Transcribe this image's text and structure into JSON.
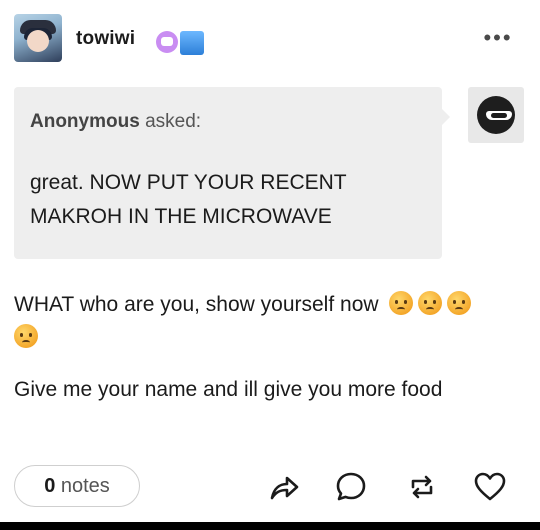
{
  "post": {
    "username": "towiwi",
    "more_label": "•••",
    "badges": [
      "sticker-badge",
      "blue-badge"
    ]
  },
  "ask": {
    "asker_name": "Anonymous",
    "asked_label": "asked:",
    "question": "great. NOW PUT YOUR RECENT MAKROH IN THE MICROWAVE"
  },
  "answer": {
    "line1": "WHAT who are you, show yourself now",
    "line2": "Give me your name and ill give you more food",
    "emoji_count": 4,
    "emoji_name": "angry-face-emoji"
  },
  "footer": {
    "notes_count": "0",
    "notes_label": "notes"
  },
  "icons": {
    "share": "share-icon",
    "reply": "reply-icon",
    "reblog": "reblog-icon",
    "like": "heart-icon"
  },
  "colors": {
    "ask_background": "#eeeeee",
    "text": "#1b1b1b",
    "muted": "#555555"
  }
}
